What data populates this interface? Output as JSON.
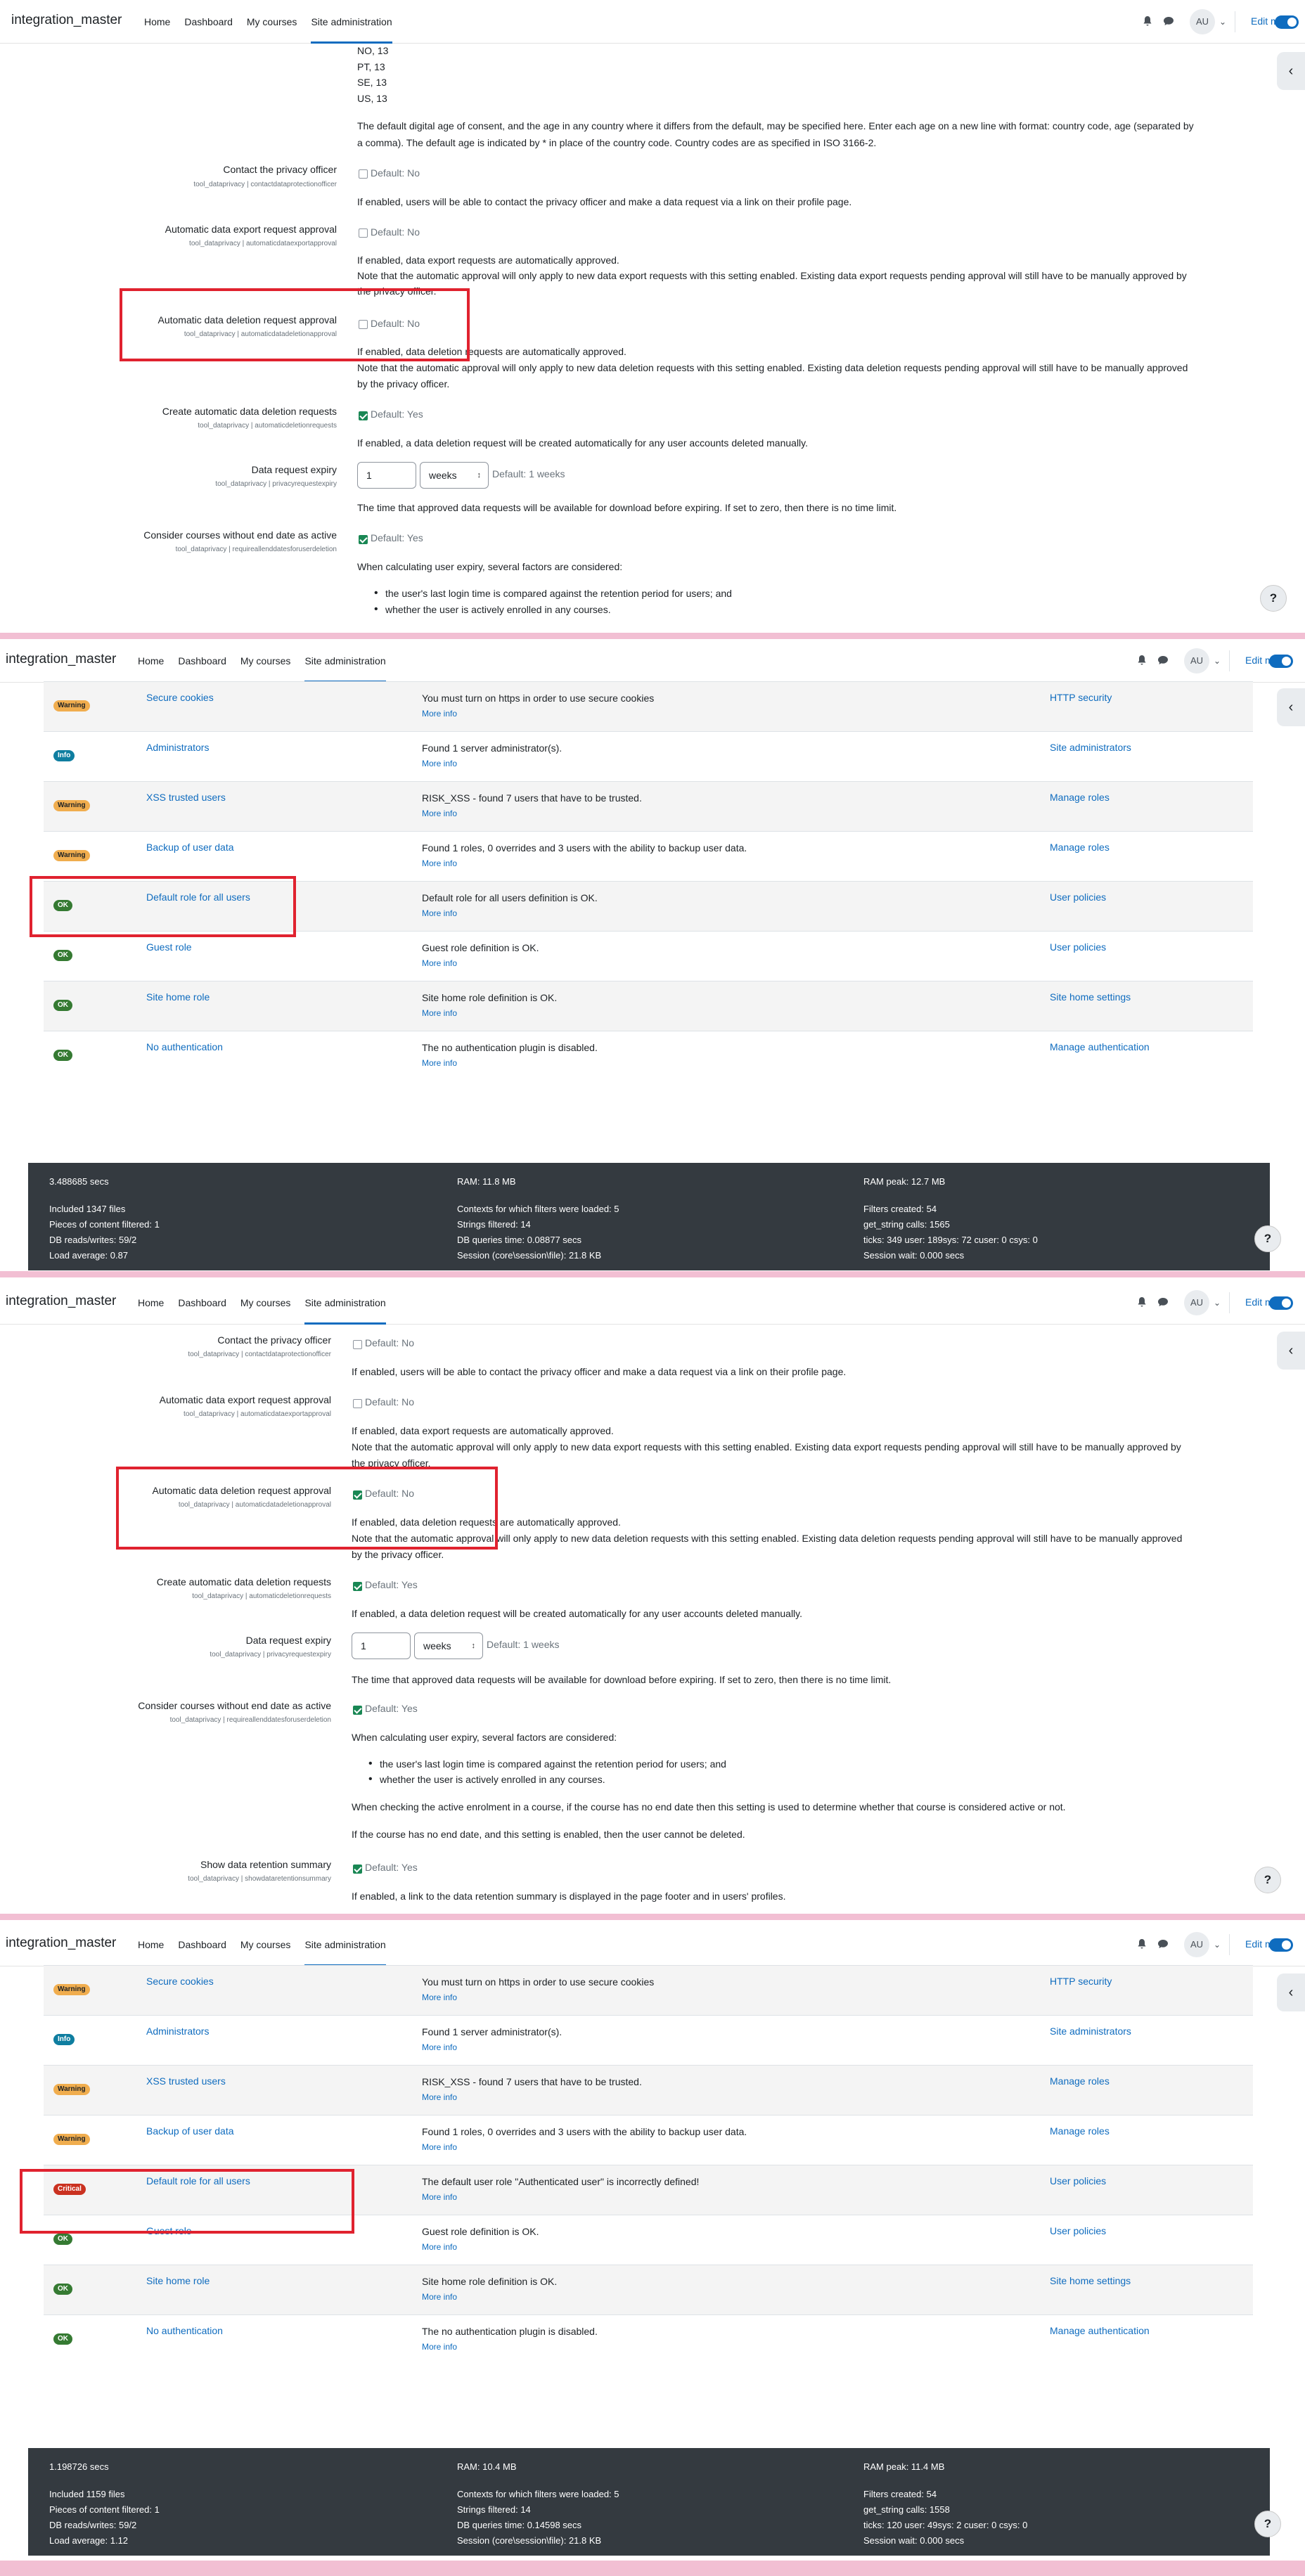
{
  "nav": {
    "site_name": "integration_master",
    "links": [
      "Home",
      "Dashboard",
      "My courses",
      "Site administration"
    ],
    "avatar": "AU",
    "edit_mode": "Edit mode"
  },
  "icons": {
    "drawer": "‹",
    "help": "?",
    "caret": "⌄"
  },
  "privacy": {
    "countries": [
      "NO, 13",
      "PT, 13",
      "SE, 13",
      "US, 13"
    ],
    "consent_desc": [
      "The default digital age of consent, and the age in any country where it differs from the default, may be specified here. Enter each age on a new line with format: country code, age (separated by",
      "a comma). The default age is indicated by * in place of the country code. Country codes are as specified in ISO 3166-2."
    ],
    "contact": {
      "label": "Contact the privacy officer",
      "sub": "tool_dataprivacy | contactdataprotectionofficer",
      "default": "Default: No",
      "desc": "If enabled, users will be able to contact the privacy officer and make a data request via a link on their profile page."
    },
    "export": {
      "label": "Automatic data export request approval",
      "sub": "tool_dataprivacy | automaticdataexportapproval",
      "default": "Default: No",
      "desc": [
        "If enabled, data export requests are automatically approved.",
        "Note that the automatic approval will only apply to new data export requests with this setting enabled. Existing data export requests pending approval will still have to be manually approved by",
        "the privacy officer."
      ]
    },
    "deletion": {
      "label": "Automatic data deletion request approval",
      "sub": "tool_dataprivacy | automaticdatadeletionapproval",
      "default": "Default: No",
      "desc": [
        "If enabled, data deletion requests are automatically approved.",
        "Note that the automatic approval will only apply to new data deletion requests with this setting enabled. Existing data deletion requests pending approval will still have to be manually approved",
        "by the privacy officer."
      ]
    },
    "create": {
      "label": "Create automatic data deletion requests",
      "sub": "tool_dataprivacy | automaticdeletionrequests",
      "default": "Default: Yes",
      "desc": "If enabled, a data deletion request will be created automatically for any user accounts deleted manually."
    },
    "expiry": {
      "label": "Data request expiry",
      "sub": "tool_dataprivacy | privacyrequestexpiry",
      "value": "1",
      "unit": "weeks",
      "default": "Default: 1 weeks",
      "desc": "The time that approved data requests will be available for download before expiring. If set to zero, then there is no time limit."
    },
    "courses": {
      "label": "Consider courses without end date as active",
      "sub": "tool_dataprivacy | requireallenddatesforuserdeletion",
      "default": "Default: Yes",
      "desc": "When calculating user expiry, several factors are considered:",
      "bullets": [
        "the user's last login time is compared against the retention period for users; and",
        "whether the user is actively enrolled in any courses."
      ],
      "p2": "When checking the active enrolment in a course, if the course has no end date then this setting is used to determine whether that course is considered active or not.",
      "p3": "If the course has no end date, and this setting is enabled, then the user cannot be deleted."
    },
    "summary": {
      "label": "Show data retention summary",
      "sub": "tool_dataprivacy | showdataretentionsummary",
      "default": "Default: Yes",
      "desc": "If enabled, a link to the data retention summary is displayed in the page footer and in users' profiles."
    }
  },
  "security": {
    "more_info": "More info",
    "rows": [
      {
        "badge": "Warning",
        "name": "Secure cookies",
        "desc": "You must turn on https in order to use secure cookies",
        "action": "HTTP security"
      },
      {
        "badge": "Info",
        "name": "Administrators",
        "desc": "Found 1 server administrator(s).",
        "action": "Site administrators"
      },
      {
        "badge": "Warning",
        "name": "XSS trusted users",
        "desc": "RISK_XSS - found 7 users that have to be trusted.",
        "action": "Manage roles"
      },
      {
        "badge": "Warning",
        "name": "Backup of user data",
        "desc": "Found 1 roles, 0 overrides and 3 users with the ability to backup user data.",
        "action": "Manage roles"
      },
      {
        "badge": "OK",
        "name": "Default role for all users",
        "desc": "Default role for all users definition is OK.",
        "action": "User policies"
      },
      {
        "badge": "OK",
        "name": "Guest role",
        "desc": "Guest role definition is OK.",
        "action": "User policies"
      },
      {
        "badge": "OK",
        "name": "Site home role",
        "desc": "Site home role definition is OK.",
        "action": "Site home settings"
      },
      {
        "badge": "OK",
        "name": "No authentication",
        "desc": "The no authentication plugin is disabled.",
        "action": "Manage authentication"
      }
    ],
    "critical_badge": "Critical",
    "critical_desc": "The default user role \"Authenticated user\" is incorrectly defined!"
  },
  "footer1": {
    "time": "3.488685 secs",
    "ram": "RAM: 11.8 MB",
    "ram_peak": "RAM peak: 12.7 MB",
    "col1": [
      "Included 1347 files",
      "Pieces of content filtered: 1",
      "DB reads/writes: 59/2",
      "Load average: 0.87"
    ],
    "col2": [
      "Contexts for which filters were loaded: 5",
      "Strings filtered: 14",
      "DB queries time: 0.08877 secs",
      "Session (core\\session\\file): 21.8 KB"
    ],
    "col3": [
      "Filters created: 54",
      "get_string calls: 1565",
      "ticks: 349 user: 189sys: 72 cuser: 0 csys: 0",
      "Session wait: 0.000 secs"
    ]
  },
  "footer2": {
    "time": "1.198726 secs",
    "ram": "RAM: 10.4 MB",
    "ram_peak": "RAM peak: 11.4 MB",
    "col1": [
      "Included 1159 files",
      "Pieces of content filtered: 1",
      "DB reads/writes: 59/2",
      "Load average: 1.12"
    ],
    "col2": [
      "Contexts for which filters were loaded: 5",
      "Strings filtered: 14",
      "DB queries time: 0.14598 secs",
      "Session (core\\session\\file): 21.8 KB"
    ],
    "col3": [
      "Filters created: 54",
      "get_string calls: 1558",
      "ticks: 120 user: 49sys: 2 cuser: 0 csys: 0",
      "Session wait: 0.000 secs"
    ]
  },
  "colors": {
    "accent": "#0f6cbf",
    "highlight": "#e0222f",
    "separator": "#f2bfd3"
  }
}
